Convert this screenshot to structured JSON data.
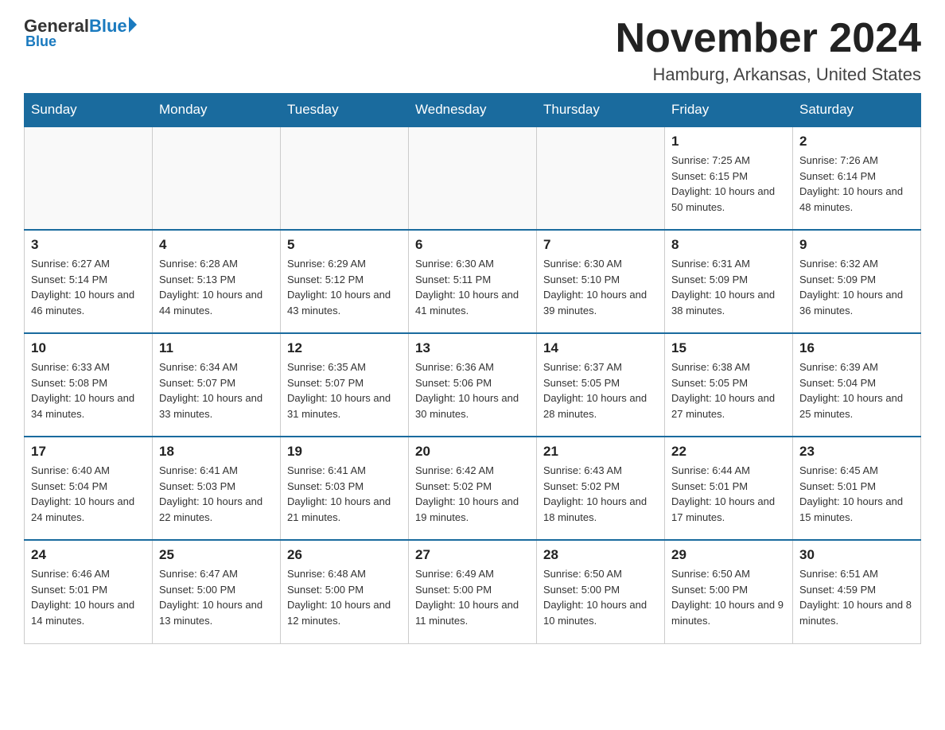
{
  "header": {
    "logo_general": "General",
    "logo_blue": "Blue",
    "month_title": "November 2024",
    "location": "Hamburg, Arkansas, United States"
  },
  "days_of_week": [
    "Sunday",
    "Monday",
    "Tuesday",
    "Wednesday",
    "Thursday",
    "Friday",
    "Saturday"
  ],
  "weeks": [
    [
      {
        "day": "",
        "info": ""
      },
      {
        "day": "",
        "info": ""
      },
      {
        "day": "",
        "info": ""
      },
      {
        "day": "",
        "info": ""
      },
      {
        "day": "",
        "info": ""
      },
      {
        "day": "1",
        "info": "Sunrise: 7:25 AM\nSunset: 6:15 PM\nDaylight: 10 hours and 50 minutes."
      },
      {
        "day": "2",
        "info": "Sunrise: 7:26 AM\nSunset: 6:14 PM\nDaylight: 10 hours and 48 minutes."
      }
    ],
    [
      {
        "day": "3",
        "info": "Sunrise: 6:27 AM\nSunset: 5:14 PM\nDaylight: 10 hours and 46 minutes."
      },
      {
        "day": "4",
        "info": "Sunrise: 6:28 AM\nSunset: 5:13 PM\nDaylight: 10 hours and 44 minutes."
      },
      {
        "day": "5",
        "info": "Sunrise: 6:29 AM\nSunset: 5:12 PM\nDaylight: 10 hours and 43 minutes."
      },
      {
        "day": "6",
        "info": "Sunrise: 6:30 AM\nSunset: 5:11 PM\nDaylight: 10 hours and 41 minutes."
      },
      {
        "day": "7",
        "info": "Sunrise: 6:30 AM\nSunset: 5:10 PM\nDaylight: 10 hours and 39 minutes."
      },
      {
        "day": "8",
        "info": "Sunrise: 6:31 AM\nSunset: 5:09 PM\nDaylight: 10 hours and 38 minutes."
      },
      {
        "day": "9",
        "info": "Sunrise: 6:32 AM\nSunset: 5:09 PM\nDaylight: 10 hours and 36 minutes."
      }
    ],
    [
      {
        "day": "10",
        "info": "Sunrise: 6:33 AM\nSunset: 5:08 PM\nDaylight: 10 hours and 34 minutes."
      },
      {
        "day": "11",
        "info": "Sunrise: 6:34 AM\nSunset: 5:07 PM\nDaylight: 10 hours and 33 minutes."
      },
      {
        "day": "12",
        "info": "Sunrise: 6:35 AM\nSunset: 5:07 PM\nDaylight: 10 hours and 31 minutes."
      },
      {
        "day": "13",
        "info": "Sunrise: 6:36 AM\nSunset: 5:06 PM\nDaylight: 10 hours and 30 minutes."
      },
      {
        "day": "14",
        "info": "Sunrise: 6:37 AM\nSunset: 5:05 PM\nDaylight: 10 hours and 28 minutes."
      },
      {
        "day": "15",
        "info": "Sunrise: 6:38 AM\nSunset: 5:05 PM\nDaylight: 10 hours and 27 minutes."
      },
      {
        "day": "16",
        "info": "Sunrise: 6:39 AM\nSunset: 5:04 PM\nDaylight: 10 hours and 25 minutes."
      }
    ],
    [
      {
        "day": "17",
        "info": "Sunrise: 6:40 AM\nSunset: 5:04 PM\nDaylight: 10 hours and 24 minutes."
      },
      {
        "day": "18",
        "info": "Sunrise: 6:41 AM\nSunset: 5:03 PM\nDaylight: 10 hours and 22 minutes."
      },
      {
        "day": "19",
        "info": "Sunrise: 6:41 AM\nSunset: 5:03 PM\nDaylight: 10 hours and 21 minutes."
      },
      {
        "day": "20",
        "info": "Sunrise: 6:42 AM\nSunset: 5:02 PM\nDaylight: 10 hours and 19 minutes."
      },
      {
        "day": "21",
        "info": "Sunrise: 6:43 AM\nSunset: 5:02 PM\nDaylight: 10 hours and 18 minutes."
      },
      {
        "day": "22",
        "info": "Sunrise: 6:44 AM\nSunset: 5:01 PM\nDaylight: 10 hours and 17 minutes."
      },
      {
        "day": "23",
        "info": "Sunrise: 6:45 AM\nSunset: 5:01 PM\nDaylight: 10 hours and 15 minutes."
      }
    ],
    [
      {
        "day": "24",
        "info": "Sunrise: 6:46 AM\nSunset: 5:01 PM\nDaylight: 10 hours and 14 minutes."
      },
      {
        "day": "25",
        "info": "Sunrise: 6:47 AM\nSunset: 5:00 PM\nDaylight: 10 hours and 13 minutes."
      },
      {
        "day": "26",
        "info": "Sunrise: 6:48 AM\nSunset: 5:00 PM\nDaylight: 10 hours and 12 minutes."
      },
      {
        "day": "27",
        "info": "Sunrise: 6:49 AM\nSunset: 5:00 PM\nDaylight: 10 hours and 11 minutes."
      },
      {
        "day": "28",
        "info": "Sunrise: 6:50 AM\nSunset: 5:00 PM\nDaylight: 10 hours and 10 minutes."
      },
      {
        "day": "29",
        "info": "Sunrise: 6:50 AM\nSunset: 5:00 PM\nDaylight: 10 hours and 9 minutes."
      },
      {
        "day": "30",
        "info": "Sunrise: 6:51 AM\nSunset: 4:59 PM\nDaylight: 10 hours and 8 minutes."
      }
    ]
  ]
}
